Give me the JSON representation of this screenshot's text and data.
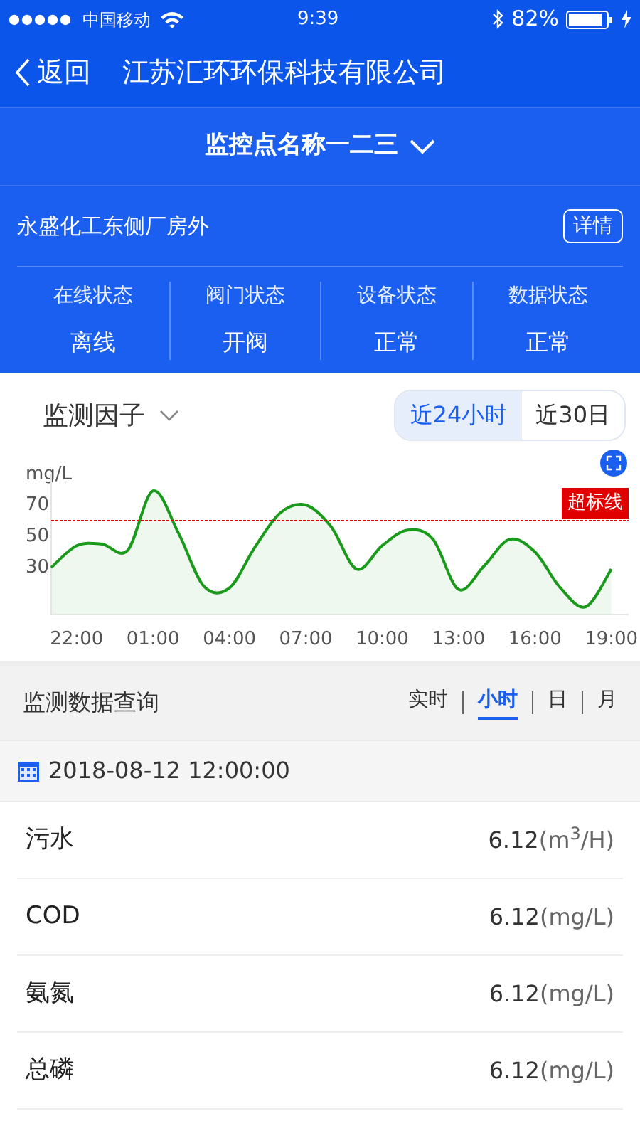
{
  "status_bar": {
    "carrier": "中国移动",
    "time": "9:39",
    "battery": "82%"
  },
  "nav": {
    "back": "返回",
    "title": "江苏汇环环保科技有限公司"
  },
  "site_selector": {
    "label": "监控点名称一二三"
  },
  "location": {
    "name": "永盛化工东侧厂房外",
    "details_button": "详情"
  },
  "statuses": [
    {
      "label": "在线状态",
      "value": "离线"
    },
    {
      "label": "阀门状态",
      "value": "开阀"
    },
    {
      "label": "设备状态",
      "value": "正常"
    },
    {
      "label": "数据状态",
      "value": "正常"
    }
  ],
  "trend": {
    "factor_label": "监测因子",
    "ranges": [
      {
        "label": "近24小时",
        "selected": true
      },
      {
        "label": "近30日",
        "selected": false
      }
    ],
    "chart_data": {
      "type": "area",
      "ylabel": "mg/L",
      "categories": [
        null,
        "22:00",
        null,
        null,
        "01:00",
        null,
        null,
        "04:00",
        null,
        null,
        "07:00",
        null,
        null,
        "10:00",
        null,
        null,
        "13:00",
        null,
        null,
        "16:00",
        null,
        null,
        "19:00"
      ],
      "series": [
        {
          "color": "#1a9a1a",
          "values": [
            30,
            44,
            45,
            41,
            79,
            52,
            18,
            17,
            43,
            65,
            70,
            56,
            29,
            44,
            54,
            48,
            16,
            31,
            48,
            40,
            17,
            5,
            29
          ]
        }
      ],
      "ylim": [
        0,
        90
      ],
      "yticks": [
        30,
        50,
        70
      ],
      "ref_lines": [
        {
          "axis": "y",
          "value": 60,
          "label": "超标线",
          "color": "#e00000"
        }
      ]
    }
  },
  "query": {
    "title": "监测数据查询",
    "periods": [
      {
        "label": "实时",
        "selected": false
      },
      {
        "label": "小时",
        "selected": true
      },
      {
        "label": "日",
        "selected": false
      },
      {
        "label": "月",
        "selected": false
      }
    ],
    "date": "2018-08-12 12:00:00"
  },
  "readings": [
    {
      "name": "污水",
      "value": "6.12",
      "unit": "(m$^{3}$/H)"
    },
    {
      "name": "COD",
      "value": "6.12",
      "unit": "(mg/L)"
    },
    {
      "name": "氨氮",
      "value": "6.12",
      "unit": "(mg/L)"
    },
    {
      "name": "总磷",
      "value": "6.12",
      "unit": "(mg/L)"
    }
  ]
}
